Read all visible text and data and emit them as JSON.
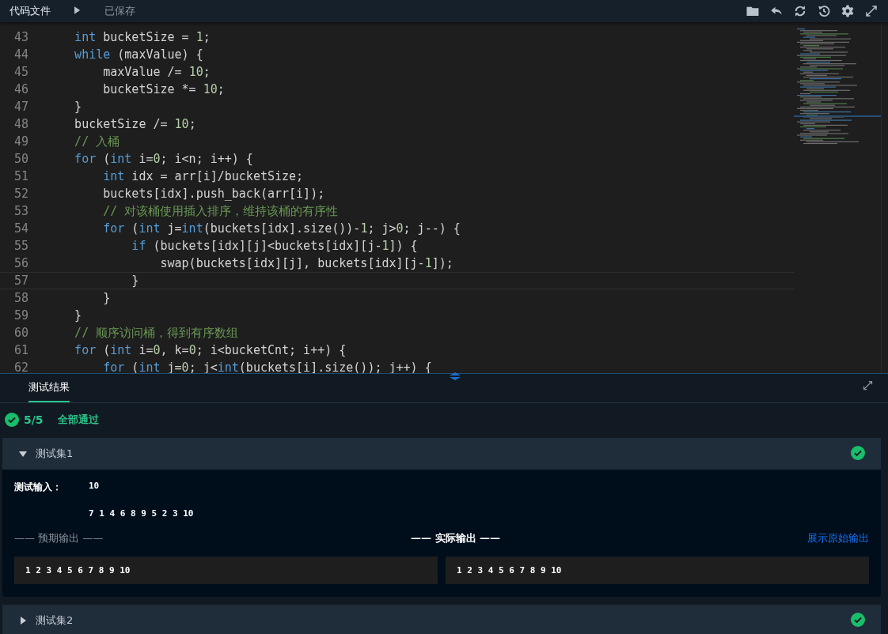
{
  "toolbar": {
    "file_tab": "代码文件",
    "save_status": "已保存"
  },
  "editor": {
    "lines": [
      {
        "number": "43",
        "current": false,
        "segments": [
          {
            "kind": "kw",
            "text": "    int"
          },
          {
            "kind": "plain",
            "text": " bucketSize = "
          },
          {
            "kind": "num",
            "text": "1"
          },
          {
            "kind": "plain",
            "text": ";"
          }
        ]
      },
      {
        "number": "44",
        "current": false,
        "segments": [
          {
            "kind": "kw",
            "text": "    while"
          },
          {
            "kind": "plain",
            "text": " (maxValue) {"
          }
        ]
      },
      {
        "number": "45",
        "current": false,
        "segments": [
          {
            "kind": "plain",
            "text": "        maxValue /= "
          },
          {
            "kind": "num",
            "text": "10"
          },
          {
            "kind": "plain",
            "text": ";"
          }
        ]
      },
      {
        "number": "46",
        "current": false,
        "segments": [
          {
            "kind": "plain",
            "text": "        bucketSize *= "
          },
          {
            "kind": "num",
            "text": "10"
          },
          {
            "kind": "plain",
            "text": ";"
          }
        ]
      },
      {
        "number": "47",
        "current": false,
        "segments": [
          {
            "kind": "plain",
            "text": "    }"
          }
        ]
      },
      {
        "number": "48",
        "current": false,
        "segments": [
          {
            "kind": "plain",
            "text": "    bucketSize /= "
          },
          {
            "kind": "num",
            "text": "10"
          },
          {
            "kind": "plain",
            "text": ";"
          }
        ]
      },
      {
        "number": "49",
        "current": false,
        "segments": [
          {
            "kind": "cm",
            "text": "    // 入桶"
          }
        ]
      },
      {
        "number": "50",
        "current": false,
        "segments": [
          {
            "kind": "kw",
            "text": "    for"
          },
          {
            "kind": "plain",
            "text": " ("
          },
          {
            "kind": "kw",
            "text": "int"
          },
          {
            "kind": "plain",
            "text": " i="
          },
          {
            "kind": "num",
            "text": "0"
          },
          {
            "kind": "plain",
            "text": "; i<n; i++) {"
          }
        ]
      },
      {
        "number": "51",
        "current": false,
        "segments": [
          {
            "kind": "kw",
            "text": "        int"
          },
          {
            "kind": "plain",
            "text": " idx = arr[i]/bucketSize;"
          }
        ]
      },
      {
        "number": "52",
        "current": false,
        "segments": [
          {
            "kind": "plain",
            "text": "        buckets[idx].push_back(arr[i]);"
          }
        ]
      },
      {
        "number": "53",
        "current": false,
        "segments": [
          {
            "kind": "cm",
            "text": "        // 对该桶使用插入排序，维持该桶的有序性"
          }
        ]
      },
      {
        "number": "54",
        "current": false,
        "segments": [
          {
            "kind": "kw",
            "text": "        for"
          },
          {
            "kind": "plain",
            "text": " ("
          },
          {
            "kind": "kw",
            "text": "int"
          },
          {
            "kind": "plain",
            "text": " j="
          },
          {
            "kind": "kw",
            "text": "int"
          },
          {
            "kind": "plain",
            "text": "(buckets[idx].size())-"
          },
          {
            "kind": "num",
            "text": "1"
          },
          {
            "kind": "plain",
            "text": "; j>"
          },
          {
            "kind": "num",
            "text": "0"
          },
          {
            "kind": "plain",
            "text": "; j--) {"
          }
        ]
      },
      {
        "number": "55",
        "current": false,
        "segments": [
          {
            "kind": "kw",
            "text": "            if"
          },
          {
            "kind": "plain",
            "text": " (buckets[idx][j]<buckets[idx][j-"
          },
          {
            "kind": "num",
            "text": "1"
          },
          {
            "kind": "plain",
            "text": "]) {"
          }
        ]
      },
      {
        "number": "56",
        "current": false,
        "segments": [
          {
            "kind": "plain",
            "text": "                swap(buckets[idx][j], buckets[idx][j-"
          },
          {
            "kind": "num",
            "text": "1"
          },
          {
            "kind": "plain",
            "text": "]);"
          }
        ]
      },
      {
        "number": "57",
        "current": true,
        "segments": [
          {
            "kind": "plain",
            "text": "            }"
          }
        ]
      },
      {
        "number": "58",
        "current": false,
        "segments": [
          {
            "kind": "plain",
            "text": "        }"
          }
        ]
      },
      {
        "number": "59",
        "current": false,
        "segments": [
          {
            "kind": "plain",
            "text": "    }"
          }
        ]
      },
      {
        "number": "60",
        "current": false,
        "segments": [
          {
            "kind": "cm",
            "text": "    // 顺序访问桶，得到有序数组"
          }
        ]
      },
      {
        "number": "61",
        "current": false,
        "segments": [
          {
            "kind": "kw",
            "text": "    for"
          },
          {
            "kind": "plain",
            "text": " ("
          },
          {
            "kind": "kw",
            "text": "int"
          },
          {
            "kind": "plain",
            "text": " i="
          },
          {
            "kind": "num",
            "text": "0"
          },
          {
            "kind": "plain",
            "text": ", k="
          },
          {
            "kind": "num",
            "text": "0"
          },
          {
            "kind": "plain",
            "text": "; i<bucketCnt; i++) {"
          }
        ]
      },
      {
        "number": "62",
        "current": false,
        "segments": [
          {
            "kind": "kw",
            "text": "        for"
          },
          {
            "kind": "plain",
            "text": " ("
          },
          {
            "kind": "kw",
            "text": "int"
          },
          {
            "kind": "plain",
            "text": " j="
          },
          {
            "kind": "num",
            "text": "0"
          },
          {
            "kind": "plain",
            "text": "; j<"
          },
          {
            "kind": "kw",
            "text": "int"
          },
          {
            "kind": "plain",
            "text": "(buckets[i].size()); j++) {"
          }
        ]
      }
    ]
  },
  "results": {
    "tabs": [
      {
        "label": "测试结果",
        "selected": true
      }
    ],
    "summary": {
      "passed": true,
      "count": "5/5",
      "status": "全部通过"
    },
    "test_sets": [
      {
        "title": "测试集1",
        "expanded": true,
        "passed": true,
        "input_label": "测试输入：",
        "input_lines": [
          "10",
          "7 1 4 6 8 9 5 2 3 10"
        ],
        "expected_heading": "—— 预期输出 ——",
        "actual_heading": "—— 实际输出 ——",
        "raw_link": "展示原始输出",
        "expected_output": "1 2 3 4 5 6 7 8 9 10",
        "actual_output": "1 2 3 4 5 6 7 8 9 10"
      },
      {
        "title": "测试集2",
        "expanded": false,
        "passed": true
      }
    ]
  }
}
